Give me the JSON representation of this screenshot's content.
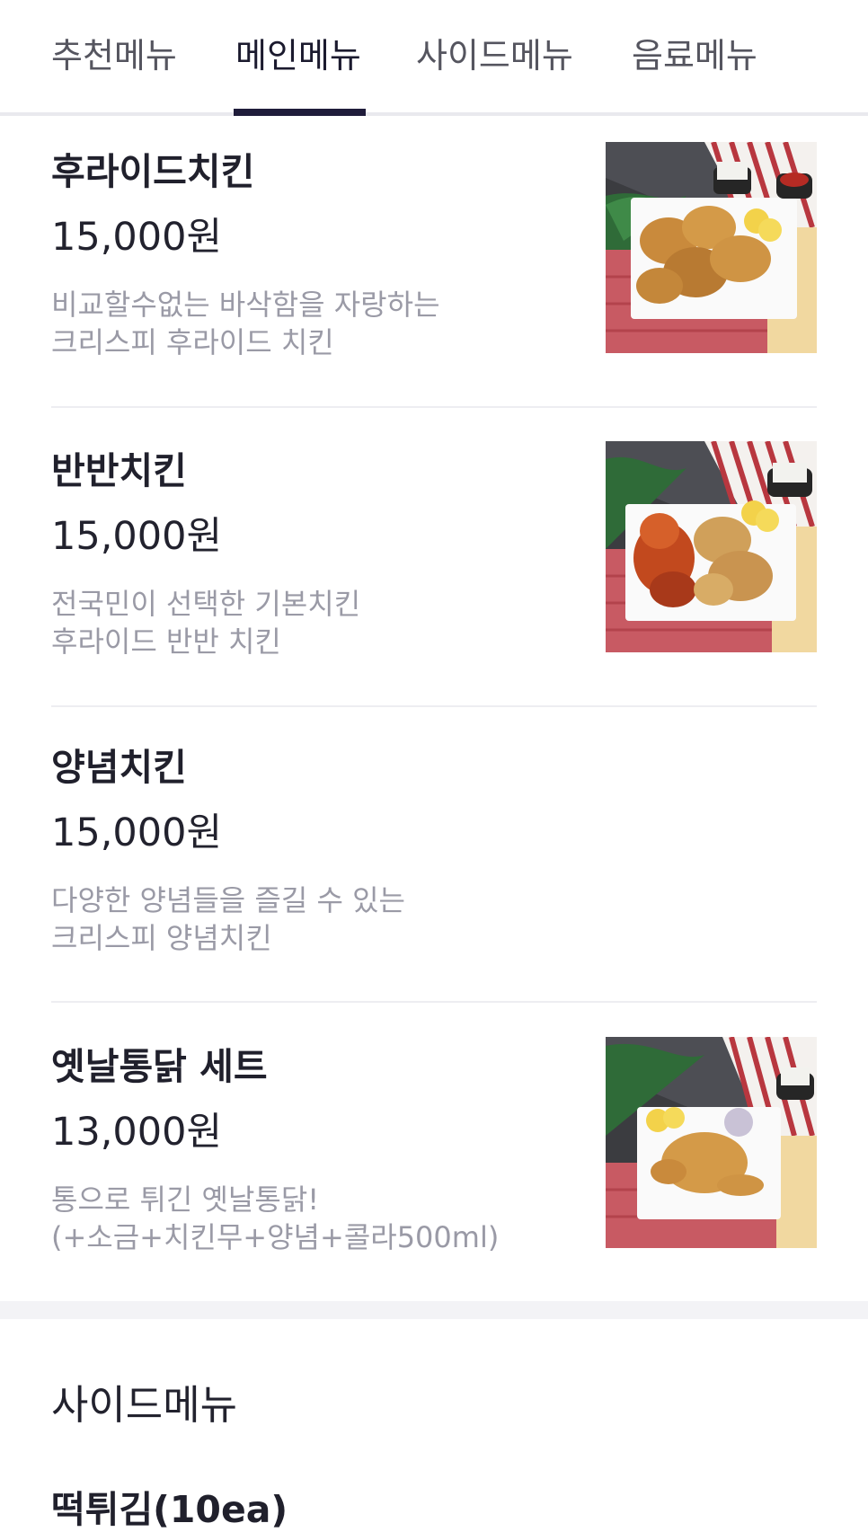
{
  "tabs": [
    {
      "label": "추천메뉴",
      "active": false
    },
    {
      "label": "메인메뉴",
      "active": true
    },
    {
      "label": "사이드메뉴",
      "active": false
    },
    {
      "label": "음료메뉴",
      "active": false
    }
  ],
  "items": [
    {
      "name": "후라이드치킨",
      "price": "15,000원",
      "desc_line1": "비교할수없는 바삭함을 자랑하는",
      "desc_line2": "크리스피 후라이드 치킨",
      "has_photo": true,
      "photo": "fried-chicken-photo"
    },
    {
      "name": "반반치킨",
      "price": "15,000원",
      "desc_line1": "전국민이 선택한 기본치킨",
      "desc_line2": "후라이드 반반 치킨",
      "has_photo": true,
      "photo": "half-half-chicken-photo"
    },
    {
      "name": "양념치킨",
      "price": "15,000원",
      "desc_line1": "다양한 양념들을 즐길 수 있는",
      "desc_line2": "크리스피 양념치킨",
      "has_photo": false
    },
    {
      "name": "옛날통닭 세트",
      "price": "13,000원",
      "desc_line1": "통으로 튀긴 옛날통닭!",
      "desc_line2": "(+소금+치킨무+양념+콜라500ml)",
      "has_photo": true,
      "photo": "whole-chicken-set-photo"
    }
  ],
  "side_section": {
    "title": "사이드메뉴",
    "first_item_partial": "떡튀김(10ea)"
  },
  "colors": {
    "accent": "#1f1c3a",
    "text": "#22222e",
    "muted": "#9a9aa6",
    "divider": "#ededf1"
  }
}
